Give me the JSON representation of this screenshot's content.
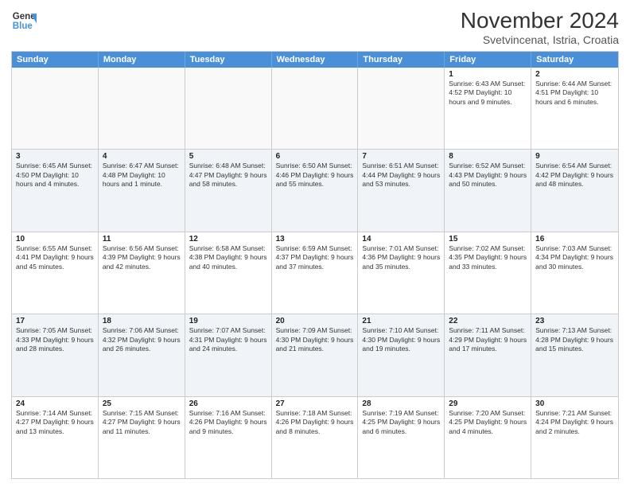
{
  "logo": {
    "line1": "General",
    "line2": "Blue"
  },
  "title": "November 2024",
  "subtitle": "Svetvincenat, Istria, Croatia",
  "days": [
    "Sunday",
    "Monday",
    "Tuesday",
    "Wednesday",
    "Thursday",
    "Friday",
    "Saturday"
  ],
  "rows": [
    [
      {
        "day": "",
        "info": ""
      },
      {
        "day": "",
        "info": ""
      },
      {
        "day": "",
        "info": ""
      },
      {
        "day": "",
        "info": ""
      },
      {
        "day": "",
        "info": ""
      },
      {
        "day": "1",
        "info": "Sunrise: 6:43 AM\nSunset: 4:52 PM\nDaylight: 10 hours and 9 minutes."
      },
      {
        "day": "2",
        "info": "Sunrise: 6:44 AM\nSunset: 4:51 PM\nDaylight: 10 hours and 6 minutes."
      }
    ],
    [
      {
        "day": "3",
        "info": "Sunrise: 6:45 AM\nSunset: 4:50 PM\nDaylight: 10 hours and 4 minutes."
      },
      {
        "day": "4",
        "info": "Sunrise: 6:47 AM\nSunset: 4:48 PM\nDaylight: 10 hours and 1 minute."
      },
      {
        "day": "5",
        "info": "Sunrise: 6:48 AM\nSunset: 4:47 PM\nDaylight: 9 hours and 58 minutes."
      },
      {
        "day": "6",
        "info": "Sunrise: 6:50 AM\nSunset: 4:46 PM\nDaylight: 9 hours and 55 minutes."
      },
      {
        "day": "7",
        "info": "Sunrise: 6:51 AM\nSunset: 4:44 PM\nDaylight: 9 hours and 53 minutes."
      },
      {
        "day": "8",
        "info": "Sunrise: 6:52 AM\nSunset: 4:43 PM\nDaylight: 9 hours and 50 minutes."
      },
      {
        "day": "9",
        "info": "Sunrise: 6:54 AM\nSunset: 4:42 PM\nDaylight: 9 hours and 48 minutes."
      }
    ],
    [
      {
        "day": "10",
        "info": "Sunrise: 6:55 AM\nSunset: 4:41 PM\nDaylight: 9 hours and 45 minutes."
      },
      {
        "day": "11",
        "info": "Sunrise: 6:56 AM\nSunset: 4:39 PM\nDaylight: 9 hours and 42 minutes."
      },
      {
        "day": "12",
        "info": "Sunrise: 6:58 AM\nSunset: 4:38 PM\nDaylight: 9 hours and 40 minutes."
      },
      {
        "day": "13",
        "info": "Sunrise: 6:59 AM\nSunset: 4:37 PM\nDaylight: 9 hours and 37 minutes."
      },
      {
        "day": "14",
        "info": "Sunrise: 7:01 AM\nSunset: 4:36 PM\nDaylight: 9 hours and 35 minutes."
      },
      {
        "day": "15",
        "info": "Sunrise: 7:02 AM\nSunset: 4:35 PM\nDaylight: 9 hours and 33 minutes."
      },
      {
        "day": "16",
        "info": "Sunrise: 7:03 AM\nSunset: 4:34 PM\nDaylight: 9 hours and 30 minutes."
      }
    ],
    [
      {
        "day": "17",
        "info": "Sunrise: 7:05 AM\nSunset: 4:33 PM\nDaylight: 9 hours and 28 minutes."
      },
      {
        "day": "18",
        "info": "Sunrise: 7:06 AM\nSunset: 4:32 PM\nDaylight: 9 hours and 26 minutes."
      },
      {
        "day": "19",
        "info": "Sunrise: 7:07 AM\nSunset: 4:31 PM\nDaylight: 9 hours and 24 minutes."
      },
      {
        "day": "20",
        "info": "Sunrise: 7:09 AM\nSunset: 4:30 PM\nDaylight: 9 hours and 21 minutes."
      },
      {
        "day": "21",
        "info": "Sunrise: 7:10 AM\nSunset: 4:30 PM\nDaylight: 9 hours and 19 minutes."
      },
      {
        "day": "22",
        "info": "Sunrise: 7:11 AM\nSunset: 4:29 PM\nDaylight: 9 hours and 17 minutes."
      },
      {
        "day": "23",
        "info": "Sunrise: 7:13 AM\nSunset: 4:28 PM\nDaylight: 9 hours and 15 minutes."
      }
    ],
    [
      {
        "day": "24",
        "info": "Sunrise: 7:14 AM\nSunset: 4:27 PM\nDaylight: 9 hours and 13 minutes."
      },
      {
        "day": "25",
        "info": "Sunrise: 7:15 AM\nSunset: 4:27 PM\nDaylight: 9 hours and 11 minutes."
      },
      {
        "day": "26",
        "info": "Sunrise: 7:16 AM\nSunset: 4:26 PM\nDaylight: 9 hours and 9 minutes."
      },
      {
        "day": "27",
        "info": "Sunrise: 7:18 AM\nSunset: 4:26 PM\nDaylight: 9 hours and 8 minutes."
      },
      {
        "day": "28",
        "info": "Sunrise: 7:19 AM\nSunset: 4:25 PM\nDaylight: 9 hours and 6 minutes."
      },
      {
        "day": "29",
        "info": "Sunrise: 7:20 AM\nSunset: 4:25 PM\nDaylight: 9 hours and 4 minutes."
      },
      {
        "day": "30",
        "info": "Sunrise: 7:21 AM\nSunset: 4:24 PM\nDaylight: 9 hours and 2 minutes."
      }
    ]
  ],
  "alt_rows": [
    1,
    3
  ]
}
